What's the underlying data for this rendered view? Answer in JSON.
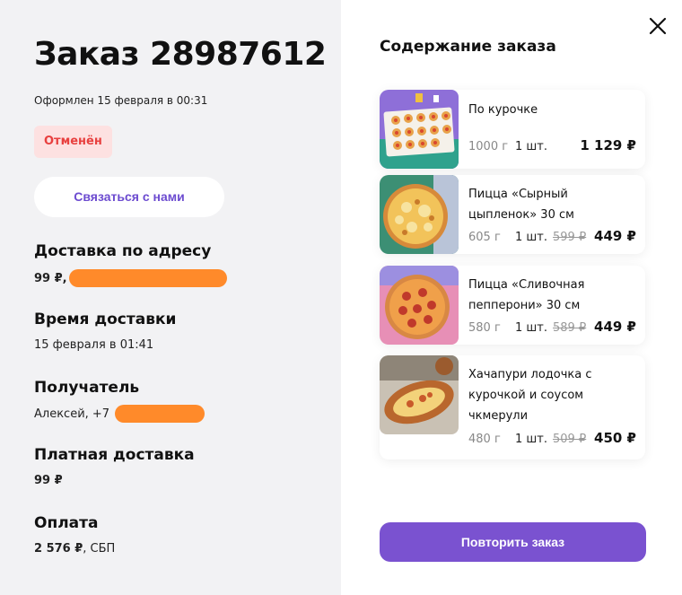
{
  "order": {
    "title": "Заказ 28987612",
    "date": "Оформлен 15 февраля в 00:31",
    "status": "Отменён",
    "contact_button": "Связаться с нами"
  },
  "sections": {
    "delivery_address": {
      "title": "Доставка по адресу",
      "value": "99 ₽,"
    },
    "delivery_time": {
      "title": "Время доставки",
      "value": "15 февраля в 01:41"
    },
    "recipient": {
      "title": "Получатель",
      "value": "Алексей, +7"
    },
    "paid_delivery": {
      "title": "Платная доставка",
      "value": "99 ₽"
    },
    "payment": {
      "title": "Оплата",
      "amount": "2 576 ₽",
      "method": ", СБП"
    }
  },
  "contents": {
    "title": "Содержание заказа",
    "items": [
      {
        "name": "По курочке",
        "weight": "1000 г",
        "qty": "1 шт.",
        "old_price": "",
        "price": "1 129 ₽",
        "icon": "rolls-image"
      },
      {
        "name": "Пицца «Сырный цыпленок» 30 см",
        "weight": "605 г",
        "qty": "1 шт.",
        "old_price": "599 ₽",
        "price": "449 ₽",
        "icon": "pizza-image"
      },
      {
        "name": "Пицца «Сливочная пепперони» 30 см",
        "weight": "580 г",
        "qty": "1 шт.",
        "old_price": "589 ₽",
        "price": "449 ₽",
        "icon": "pizza-image"
      },
      {
        "name": "Хачапури лодочка с курочкой и соусом чкмерули",
        "weight": "480 г",
        "qty": "1 шт.",
        "old_price": "509 ₽",
        "price": "450 ₽",
        "icon": "khachapuri-image"
      }
    ]
  },
  "repeat_button": "Повторить заказ",
  "colors": {
    "accent": "#7a52d0",
    "status_bg": "#fde1e1",
    "status_text": "#e8403f",
    "redaction": "#ff8a2a"
  }
}
